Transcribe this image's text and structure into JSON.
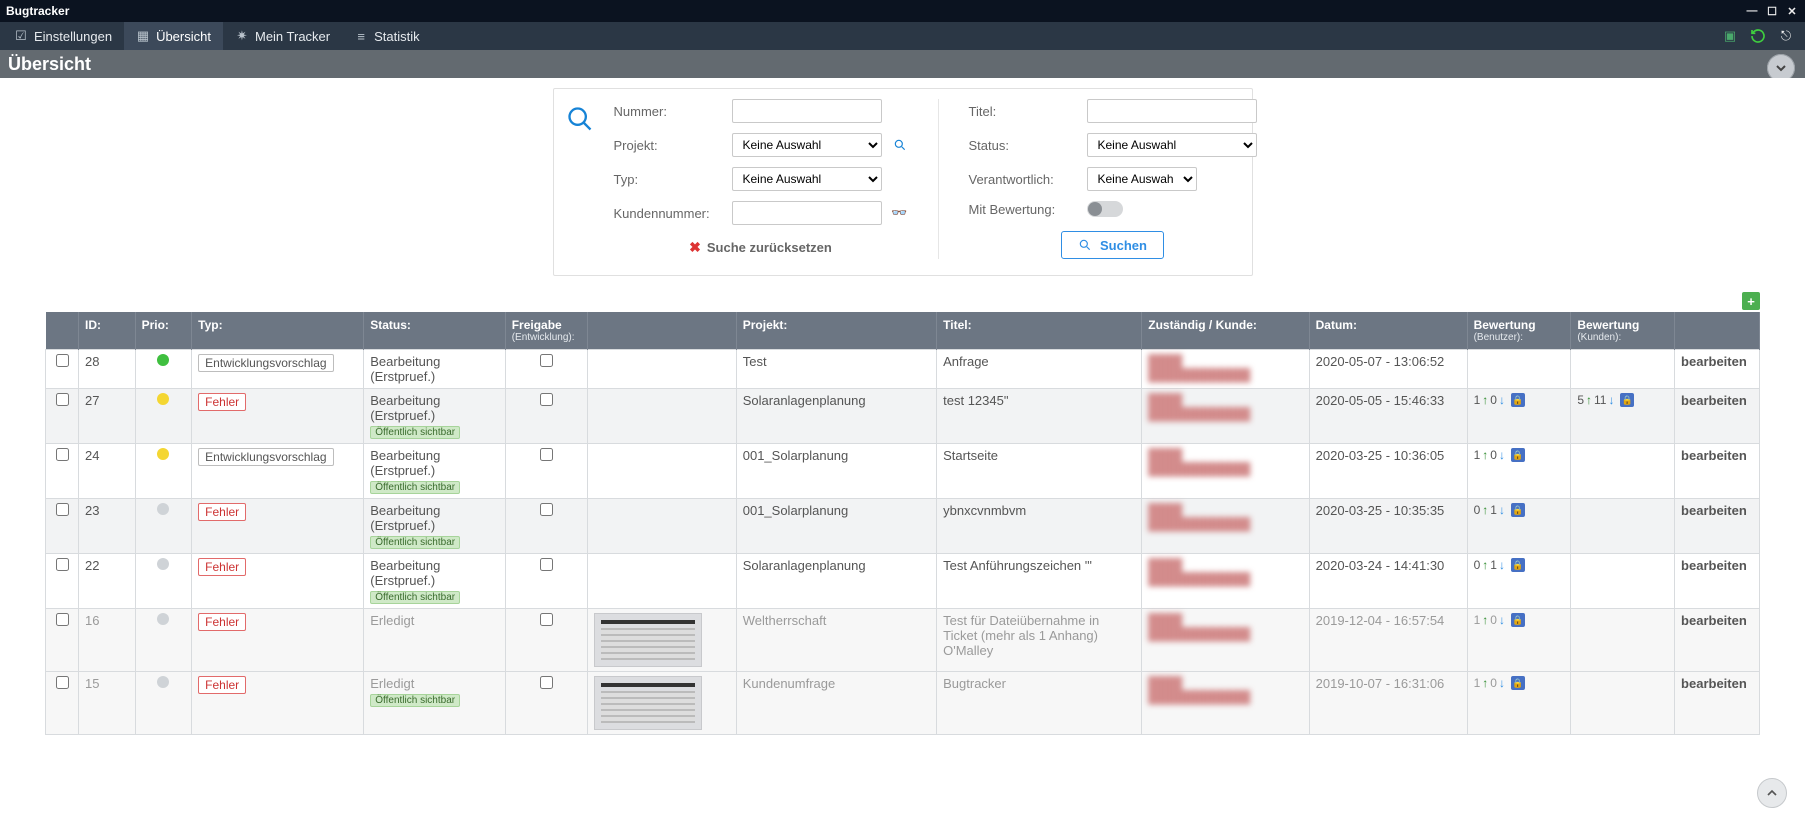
{
  "app": {
    "title": "Bugtracker"
  },
  "nav": {
    "settings": "Einstellungen",
    "overview": "Übersicht",
    "mytracker": "Mein Tracker",
    "statistic": "Statistik"
  },
  "page": {
    "heading": "Übersicht"
  },
  "search": {
    "labels": {
      "number": "Nummer:",
      "project": "Projekt:",
      "type": "Typ:",
      "customerNumber": "Kundennummer:",
      "title": "Titel:",
      "status": "Status:",
      "responsible": "Verantwortlich:",
      "withRating": "Mit Bewertung:"
    },
    "noSelection": "Keine Auswahl",
    "reset": "Suche zurücksetzen",
    "submit": "Suchen"
  },
  "columns": {
    "id": "ID:",
    "prio": "Prio:",
    "typ": "Typ:",
    "status": "Status:",
    "freigabe": "Freigabe",
    "freigabeSub": "(Entwicklung):",
    "thumb": "",
    "projekt": "Projekt:",
    "titel": "Titel:",
    "zust": "Zuständig / Kunde:",
    "datum": "Datum:",
    "bwUser": "Bewertung",
    "bwUserSub": "(Benutzer):",
    "bwKunde": "Bewertung",
    "bwKundeSub": "(Kunden):",
    "edit": ""
  },
  "badges": {
    "public": "Öffentlich sichtbar",
    "type_ev": "Entwicklungsvorschlag",
    "type_err": "Fehler"
  },
  "editLabel": "bearbeiten",
  "rows": [
    {
      "id": "28",
      "prio": "green",
      "type": "ev",
      "status": "Bearbeitung (Erstpruef.)",
      "public": false,
      "projekt": "Test",
      "titel": "Anfrage",
      "datum": "2020-05-07 - 13:06:52",
      "bwUser": null,
      "bwKunde": null,
      "thumb": false,
      "dim": false
    },
    {
      "id": "27",
      "prio": "yellow",
      "type": "err",
      "status": "Bearbeitung (Erstpruef.)",
      "public": true,
      "projekt": "Solaranlagenplanung",
      "titel": "test 12345\"",
      "datum": "2020-05-05 - 15:46:33",
      "bwUser": {
        "up": 1,
        "down": 0,
        "lock": true
      },
      "bwKunde": {
        "up": 5,
        "down": 11,
        "lock": true
      },
      "thumb": false,
      "dim": false,
      "alt": true
    },
    {
      "id": "24",
      "prio": "yellow",
      "type": "ev",
      "status": "Bearbeitung (Erstpruef.)",
      "public": true,
      "projekt": "001_Solarplanung",
      "titel": "Startseite",
      "datum": "2020-03-25 - 10:36:05",
      "bwUser": {
        "up": 1,
        "down": 0,
        "lock": true
      },
      "bwKunde": null,
      "thumb": false,
      "dim": false
    },
    {
      "id": "23",
      "prio": "grey",
      "type": "err",
      "status": "Bearbeitung (Erstpruef.)",
      "public": true,
      "projekt": "001_Solarplanung",
      "titel": "ybnxcvnmbvm",
      "datum": "2020-03-25 - 10:35:35",
      "bwUser": {
        "up": 0,
        "down": 1,
        "lock": true
      },
      "bwKunde": null,
      "thumb": false,
      "dim": false,
      "alt": true
    },
    {
      "id": "22",
      "prio": "grey",
      "type": "err",
      "status": "Bearbeitung (Erstpruef.)",
      "public": true,
      "projekt": "Solaranlagenplanung",
      "titel": "Test Anführungszeichen '\"",
      "datum": "2020-03-24 - 14:41:30",
      "bwUser": {
        "up": 0,
        "down": 1,
        "lock": true
      },
      "bwKunde": null,
      "thumb": false,
      "dim": false
    },
    {
      "id": "16",
      "prio": "grey",
      "type": "err",
      "status": "Erledigt",
      "public": false,
      "projekt": "Weltherrschaft",
      "titel": "Test für Dateiübernahme in Ticket (mehr als 1 Anhang) O'Malley",
      "datum": "2019-12-04 - 16:57:54",
      "bwUser": {
        "up": 1,
        "down": 0,
        "lock": true
      },
      "bwKunde": null,
      "thumb": true,
      "dim": true,
      "alt": true
    },
    {
      "id": "15",
      "prio": "grey",
      "type": "err",
      "status": "Erledigt",
      "public": true,
      "projekt": "Kundenumfrage",
      "titel": "Bugtracker",
      "datum": "2019-10-07 - 16:31:06",
      "bwUser": {
        "up": 1,
        "down": 0,
        "lock": true
      },
      "bwKunde": null,
      "thumb": true,
      "dim": true
    }
  ]
}
